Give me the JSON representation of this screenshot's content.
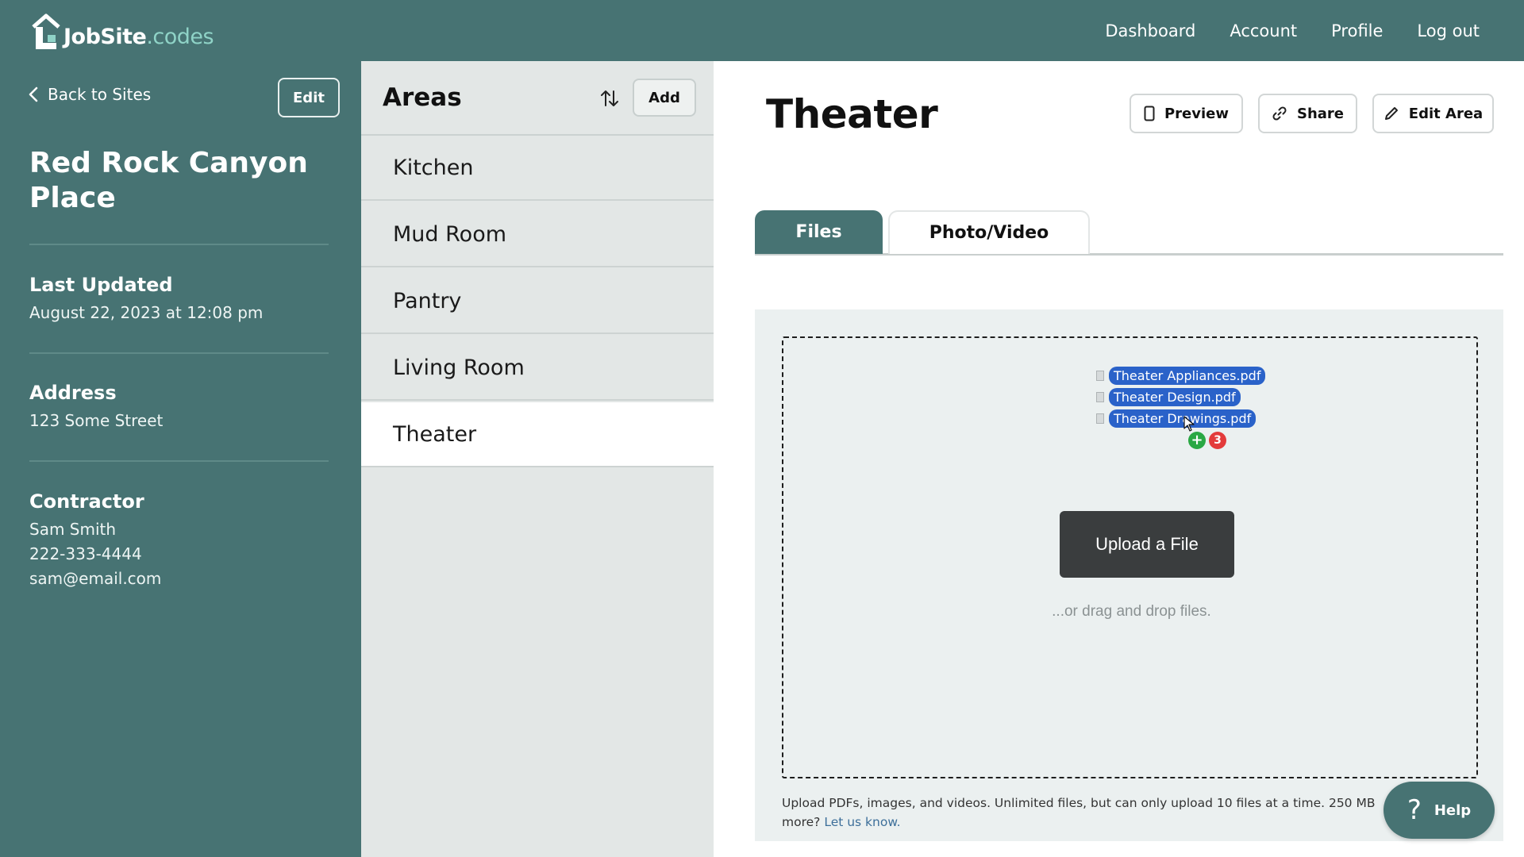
{
  "logo": {
    "brand": "JobSite",
    "suffix": ".codes"
  },
  "nav": {
    "items": [
      {
        "label": "Dashboard"
      },
      {
        "label": "Account"
      },
      {
        "label": "Profile"
      },
      {
        "label": "Log out"
      }
    ]
  },
  "sidebar": {
    "back_label": "Back to Sites",
    "edit_label": "Edit",
    "site_name": "Red Rock Canyon Place",
    "last_updated": {
      "label": "Last Updated",
      "value": "August 22, 2023 at 12:08 pm"
    },
    "address": {
      "label": "Address",
      "value": "123 Some Street"
    },
    "contractor": {
      "label": "Contractor",
      "name": "Sam Smith",
      "phone": "222-333-4444",
      "email": "sam@email.com"
    }
  },
  "areas": {
    "title": "Areas",
    "add_label": "Add",
    "items": [
      {
        "label": "Kitchen",
        "active": false
      },
      {
        "label": "Mud Room",
        "active": false
      },
      {
        "label": "Pantry",
        "active": false
      },
      {
        "label": "Living Room",
        "active": false
      },
      {
        "label": "Theater",
        "active": true
      }
    ]
  },
  "main": {
    "title": "Theater",
    "actions": {
      "preview_label": "Preview",
      "share_label": "Share",
      "edit_area_label": "Edit Area"
    },
    "tabs": [
      {
        "label": "Files",
        "active": true
      },
      {
        "label": "Photo/Video",
        "active": false
      }
    ],
    "upload": {
      "dragged_files": [
        "Theater Appliances.pdf",
        "Theater Design.pdf",
        "Theater Drawings.pdf"
      ],
      "drag_count": "3",
      "button_label": "Upload a File",
      "hint": "...or drag and drop files.",
      "note": "Upload PDFs, images, and videos. Unlimited files, but can only upload 10 files at a time. 250 MB",
      "note_more": "more?",
      "note_link": "Let us know."
    }
  },
  "help": {
    "label": "Help"
  },
  "colors": {
    "brand": "#477373",
    "areas_bg": "#e3e7e6",
    "file_pill": "#2a62c9",
    "upload_button": "#3a3d3e"
  }
}
